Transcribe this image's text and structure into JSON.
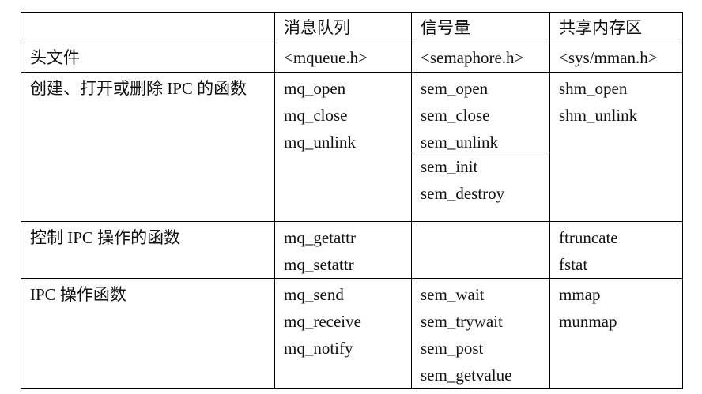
{
  "table": {
    "headers": [
      "",
      "消息队列",
      "信号量",
      "共享内存区"
    ],
    "rows": [
      {
        "label": "头文件",
        "mq": [
          "<mqueue.h>"
        ],
        "sem": [
          "<semaphore.h>"
        ],
        "shm": [
          "<sys/mman.h>"
        ]
      },
      {
        "label": "创建、打开或删除 IPC 的函数",
        "mq": [
          "mq_open",
          "mq_close",
          "mq_unlink"
        ],
        "sem_top": [
          "sem_open",
          "sem_close",
          "sem_unlink"
        ],
        "sem_bottom": [
          "sem_init",
          "sem_destroy"
        ],
        "shm": [
          "shm_open",
          "shm_unlink"
        ]
      },
      {
        "label": "控制 IPC 操作的函数",
        "mq": [
          "mq_getattr",
          "mq_setattr"
        ],
        "sem": [],
        "shm": [
          "ftruncate",
          "fstat"
        ]
      },
      {
        "label": "IPC 操作函数",
        "mq": [
          "mq_send",
          "mq_receive",
          "mq_notify"
        ],
        "sem": [
          "sem_wait",
          "sem_trywait",
          "sem_post",
          "sem_getvalue"
        ],
        "shm": [
          "mmap",
          "munmap"
        ]
      }
    ]
  }
}
